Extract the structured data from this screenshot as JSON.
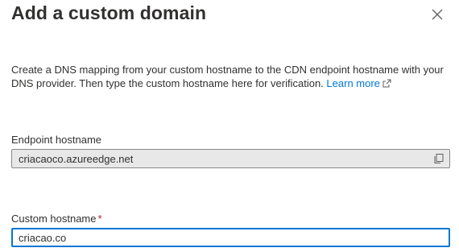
{
  "dialog": {
    "title": "Add a custom domain",
    "close_icon": "close-icon"
  },
  "description": {
    "text": "Create a DNS mapping from your custom hostname to the CDN endpoint hostname with your DNS provider. Then type the custom hostname here for verification.",
    "link_label": "Learn more",
    "link_icon": "external-link-icon"
  },
  "endpoint": {
    "label": "Endpoint hostname",
    "value": "criacaoco.azureedge.net",
    "copy_icon": "copy-icon"
  },
  "custom": {
    "label": "Custom hostname",
    "required_mark": "*",
    "value": "criacao.co"
  },
  "colors": {
    "accent": "#0078d4",
    "required": "#a4262c",
    "readonly_bg": "#e8e8e8"
  }
}
